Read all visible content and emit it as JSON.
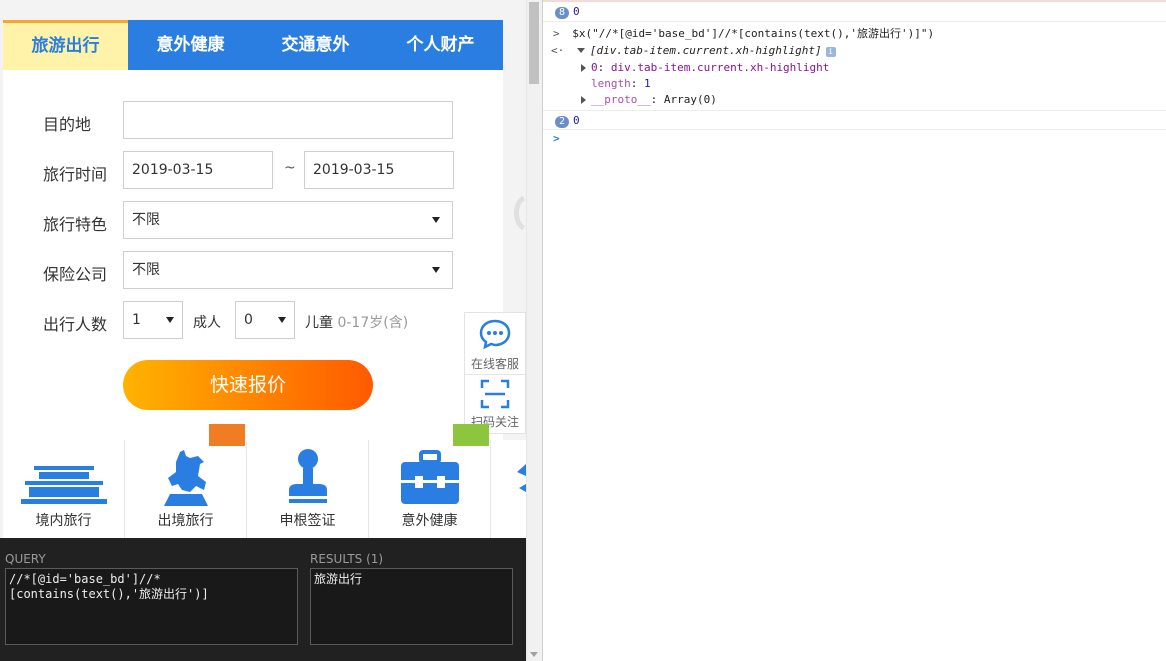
{
  "tabs": [
    "旅游出行",
    "意外健康",
    "交通意外",
    "个人财产"
  ],
  "form": {
    "destination_label": "目的地",
    "destination_value": "",
    "travel_time_label": "旅行时间",
    "date_start": "2019-03-15",
    "date_separator": "~",
    "date_end": "2019-03-15",
    "feature_label": "旅行特色",
    "feature_value": "不限",
    "insurer_label": "保险公司",
    "insurer_value": "不限",
    "people_label": "出行人数",
    "adults_value": "1",
    "adults_unit": "成人",
    "children_value": "0",
    "children_unit": "儿童",
    "children_hint": "0-17岁(含)",
    "submit_label": "快速报价"
  },
  "side_float": {
    "service_label": "在线客服",
    "follow_label": "扫码关注"
  },
  "categories": [
    "境内旅行",
    "出境旅行",
    "申根签证",
    "意外健康"
  ],
  "xpath_helper": {
    "query_title": "QUERY",
    "query_text": "//*[@id='base_bd']//*[contains(text(),'旅游出行')]",
    "results_title": "RESULTS (1)",
    "results_text": "旅游出行"
  },
  "console": {
    "line1_count": "8",
    "line1_value": "0",
    "command_prompt": ">",
    "command": "$x(\"//*[@id='base_bd']//*[contains(text(),'旅游出行')]\")",
    "result_back": "<·",
    "result_summary": "[div.tab-item.current.xh-highlight]",
    "result_item_key": "0",
    "result_item_value": "div.tab-item.current.xh-highlight",
    "length_key": "length",
    "length_value": "1",
    "proto_key": "__proto__",
    "proto_value": "Array(0)",
    "line2_count": "2",
    "line2_value": "0",
    "input_prompt": ">"
  },
  "colors": {
    "primary_blue": "#2b7ee1",
    "active_tab_bg": "#fef3a8",
    "button_gradient_start": "#ffb300",
    "button_gradient_end": "#ff5a00"
  }
}
